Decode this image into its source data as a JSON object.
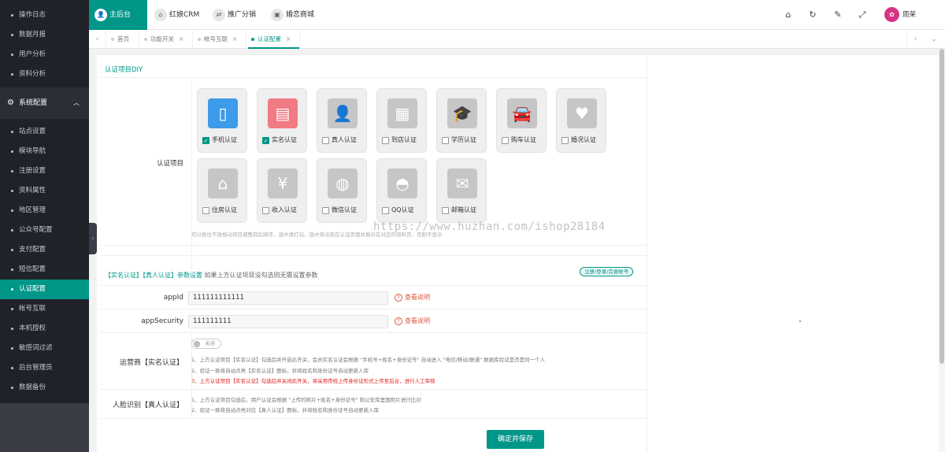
{
  "sidebar": {
    "top_items": [
      "操作日志",
      "数据月报",
      "用户分析",
      "资料分析"
    ],
    "section": "系统配置",
    "items": [
      "站点设置",
      "模块导航",
      "注册设置",
      "资料属性",
      "地区管理",
      "公众号配置",
      "支付配置",
      "短信配置",
      "认证配置",
      "帐号互联",
      "本机授权",
      "敏感词过滤",
      "后台管理员",
      "数据备份"
    ],
    "active": "认证配置"
  },
  "header": {
    "tabs": [
      {
        "label": "主后台",
        "icon": "user-icon"
      },
      {
        "label": "红娘CRM",
        "icon": "home-icon"
      },
      {
        "label": "推广分销",
        "icon": "share-icon"
      },
      {
        "label": "婚恋商城",
        "icon": "shop-icon"
      }
    ],
    "user": "周荣",
    "icons": [
      "home-icon",
      "refresh-icon",
      "broom-icon",
      "fullscreen-icon"
    ]
  },
  "page_tabs": [
    {
      "label": "首页",
      "closable": false
    },
    {
      "label": "功能开关",
      "closable": true
    },
    {
      "label": "帐号互联",
      "closable": true
    },
    {
      "label": "认证配置",
      "closable": true,
      "active": true
    }
  ],
  "auth_diy": {
    "section_title": "认证项目DIY",
    "label": "认证项目",
    "items": [
      {
        "label": "手机认证",
        "checked": true,
        "icon": "phone-icon",
        "color": "#3d9be9"
      },
      {
        "label": "实名认证",
        "checked": true,
        "icon": "idcard-icon",
        "color": "#f07b82"
      },
      {
        "label": "真人认证",
        "checked": false,
        "icon": "person-icon"
      },
      {
        "label": "到店认证",
        "checked": false,
        "icon": "store-icon"
      },
      {
        "label": "学历认证",
        "checked": false,
        "icon": "graduation-icon"
      },
      {
        "label": "购车认证",
        "checked": false,
        "icon": "car-icon"
      },
      {
        "label": "婚况认证",
        "checked": false,
        "icon": "heart-icon"
      },
      {
        "label": "住房认证",
        "checked": false,
        "icon": "house-icon"
      },
      {
        "label": "收入认证",
        "checked": false,
        "icon": "yen-icon"
      },
      {
        "label": "微信认证",
        "checked": false,
        "icon": "wechat-icon"
      },
      {
        "label": "QQ认证",
        "checked": false,
        "icon": "qq-icon"
      },
      {
        "label": "邮箱认证",
        "checked": false,
        "icon": "mail-icon"
      }
    ],
    "hint": "可以按住不放拖动项目调整前后顺序，选中请打勾，选中将出现在认证页面并展示在对应的资料页，否则不显示"
  },
  "params": {
    "title": "【实名认证】【真人认证】参数设置",
    "subtitle": "如果上方认证项目没勾选则无需设置参数",
    "reg_button": "注册/登录/完善帐号",
    "appid_label": "appId",
    "appid_value": "111111111111",
    "appsecurity_label": "appSecurity",
    "appsecurity_value": "111111111",
    "help_text": "查看说明",
    "operator_label": "运营商【实名认证】",
    "toggle_text": "关闭",
    "operator_notes": [
      "1、上方认证项目【实名认证】勾选后并开启此开关，会员实名认证会根据 \"手机号+姓名+身份证号\" 自动进入 \"电信/移动/联通\" 数据库验证是否是同一个人",
      "2、验证一致将自动点亮【实名认证】图标，并将姓名和身份证号自动更新入库",
      "3、上方认证项目【实名认证】勾选后并关闭此开关，将采用传统上传身份证形式上传至后台，进行人工审核"
    ],
    "face_label": "人脸识别【真人认证】",
    "face_notes": [
      "1、上方认证项目勾选后，用户认证会根据 \"上传的照片+姓名+身份证号\" 和公安库里面照片进行比对",
      "2、验证一致将自动点亮对应【真人认证】图标，并将姓名和身份证号自动更新入库"
    ]
  },
  "save_button": "确定并保存",
  "watermark": "https://www.huzhan.com/ishop28184"
}
